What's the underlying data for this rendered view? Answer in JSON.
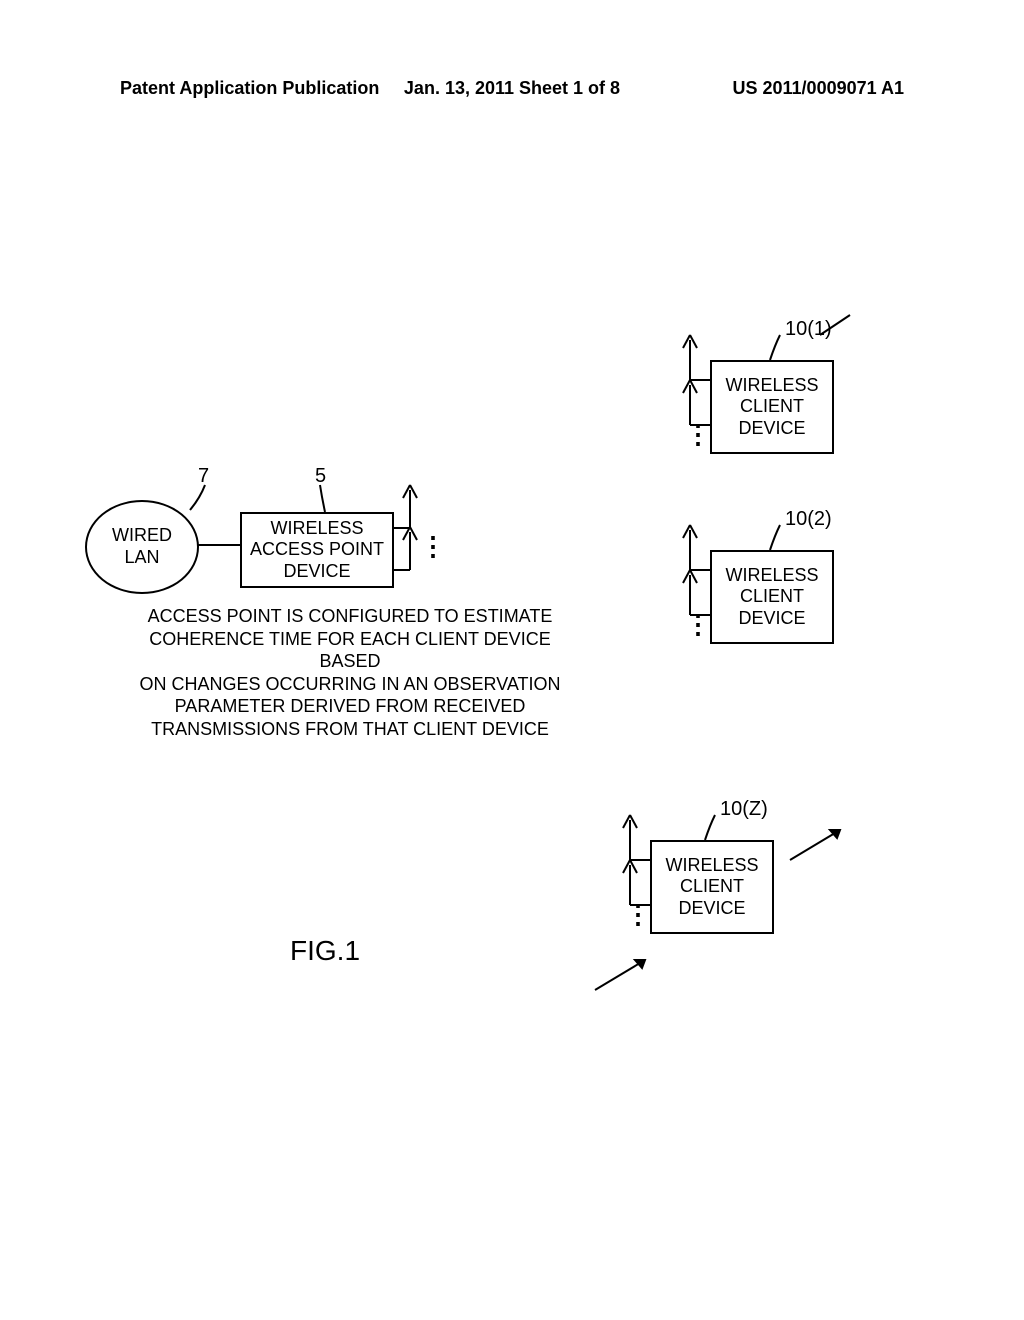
{
  "header": {
    "left": "Patent Application Publication",
    "mid": "Jan. 13, 2011  Sheet 1 of 8",
    "right": "US 2011/0009071 A1"
  },
  "wired_lan": {
    "label_l1": "WIRED",
    "label_l2": "LAN"
  },
  "ap": {
    "label_l1": "WIRELESS",
    "label_l2": "ACCESS POINT",
    "label_l3": "DEVICE",
    "ref": "5"
  },
  "lan_ref": "7",
  "caption": {
    "l1": "ACCESS POINT IS CONFIGURED TO ESTIMATE",
    "l2": "COHERENCE TIME FOR EACH CLIENT DEVICE BASED",
    "l3": "ON CHANGES OCCURRING IN AN OBSERVATION",
    "l4": "PARAMETER DERIVED FROM RECEIVED",
    "l5": "TRANSMISSIONS FROM THAT CLIENT DEVICE"
  },
  "clients": {
    "label_l1": "WIRELESS",
    "label_l2": "CLIENT",
    "label_l3": "DEVICE",
    "ref1": "10(1)",
    "ref2": "10(2)",
    "refZ": "10(Z)"
  },
  "fig": "FIG.1",
  "chart_data": {
    "type": "table",
    "title": "Wireless network topology",
    "series": [
      {
        "name": "Wireless Access Point Device",
        "ref": "5",
        "connects_to": [
          "Wired LAN (7)",
          "Wireless Client Device 10(1)",
          "Wireless Client Device 10(2)",
          "Wireless Client Device 10(Z)"
        ]
      }
    ]
  }
}
